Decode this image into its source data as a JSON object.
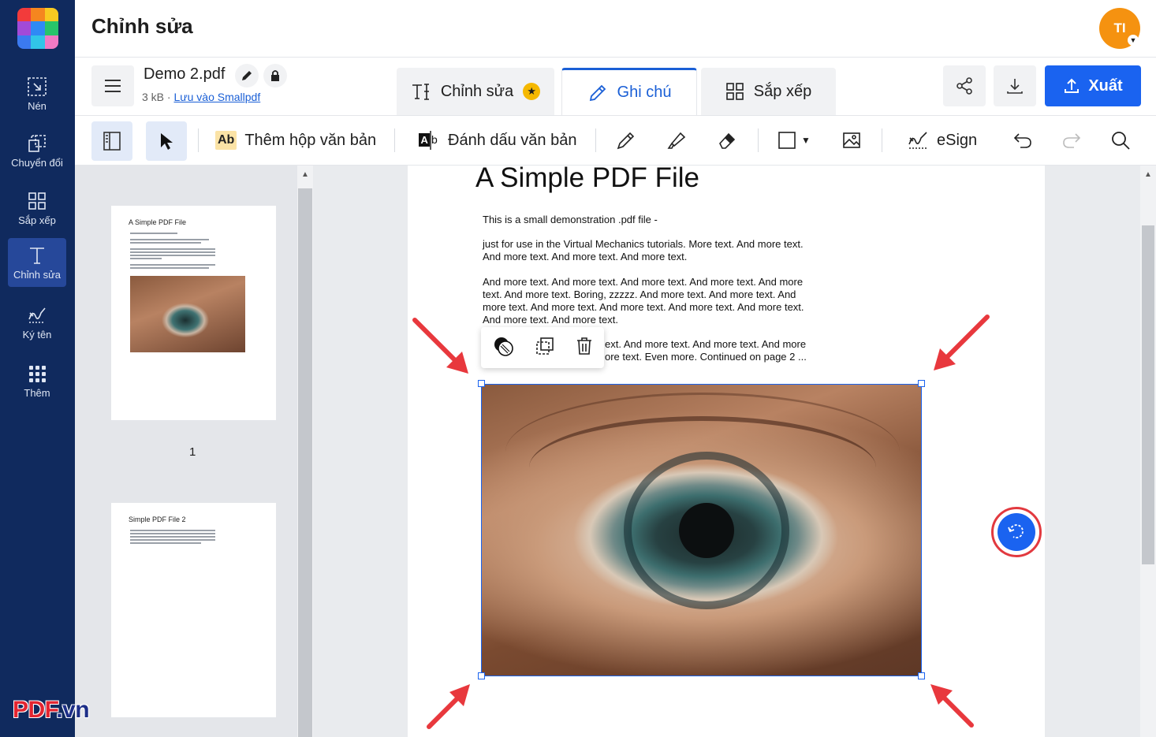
{
  "header": {
    "title": "Chỉnh sửa",
    "avatar_initials": "TI"
  },
  "sidebar": {
    "items": [
      {
        "label": "Nén",
        "icon": "compress-icon"
      },
      {
        "label": "Chuyển đổi",
        "icon": "convert-icon"
      },
      {
        "label": "Sắp xếp",
        "icon": "organize-icon"
      },
      {
        "label": "Chỉnh sửa",
        "icon": "edit-text-icon",
        "active": true
      },
      {
        "label": "Ký tên",
        "icon": "signature-icon"
      },
      {
        "label": "Thêm",
        "icon": "grid-dots-icon"
      }
    ]
  },
  "file": {
    "name": "Demo 2.pdf",
    "size": "3 kB",
    "separator": "·",
    "save_link": "Lưu vào Smallpdf"
  },
  "tabs": [
    {
      "label": "Chỉnh sửa",
      "icon": "text-edit-icon",
      "badge": "star-icon"
    },
    {
      "label": "Ghi chú",
      "icon": "pencil-icon",
      "active": true
    },
    {
      "label": "Sắp xếp",
      "icon": "grid-icon"
    }
  ],
  "actions": {
    "export_label": "Xuất"
  },
  "toolbar": {
    "add_textbox": "Thêm hộp văn bản",
    "add_textbox_badge": "Ab",
    "highlight_text": "Đánh dấu văn bản",
    "esign": "eSign"
  },
  "thumbnails": [
    {
      "title": "A Simple PDF File",
      "number": "1"
    },
    {
      "title": "Simple PDF File 2"
    }
  ],
  "pdf": {
    "title": "A Simple PDF File",
    "paragraphs": [
      "This is a small demonstration .pdf file -",
      "just for use in the Virtual Mechanics tutorials. More text. And more text. And more text. And more text. And more text.",
      "And more text. And more text. And more text. And more text. And more text. And more text. Boring, zzzzz. And more text. And more text. And more text. And more text. And more text. And more text. And more text. And more text. And more text.",
      "ext. And more text. And more text. And more",
      "ore text. Even more. Continued on page 2 ..."
    ]
  },
  "watermark": {
    "main": "PDF",
    "suffix": ".vn"
  },
  "colors": {
    "sidebar_bg": "#102a5e",
    "accent": "#1a63f0",
    "arrow": "#e8383d",
    "avatar": "#f59210"
  }
}
